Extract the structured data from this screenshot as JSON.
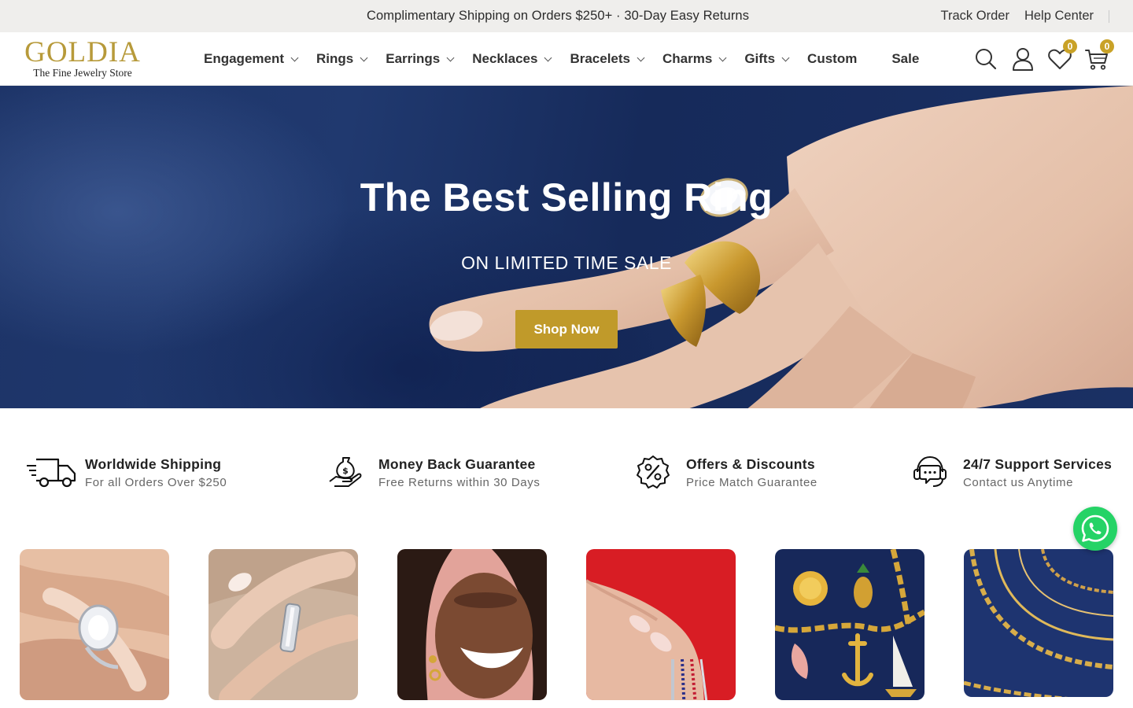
{
  "topbar": {
    "promo": "Complimentary Shipping on Orders $250+ · 30-Day Easy Returns",
    "track_order": "Track Order",
    "help_center": "Help Center"
  },
  "logo": {
    "word": "GOLDIA",
    "tagline": "The Fine Jewelry Store"
  },
  "nav": {
    "items": [
      {
        "label": "Engagement",
        "has_dropdown": true
      },
      {
        "label": "Rings",
        "has_dropdown": true
      },
      {
        "label": "Earrings",
        "has_dropdown": true
      },
      {
        "label": "Necklaces",
        "has_dropdown": true
      },
      {
        "label": "Bracelets",
        "has_dropdown": true
      },
      {
        "label": "Charms",
        "has_dropdown": true
      },
      {
        "label": "Gifts",
        "has_dropdown": true
      },
      {
        "label": "Custom",
        "has_dropdown": false
      },
      {
        "label": "Sale",
        "has_dropdown": false
      }
    ]
  },
  "header_icons": {
    "search": "search-icon",
    "account": "user-icon",
    "wishlist": "heart-icon",
    "wishlist_count": "0",
    "cart": "cart-icon",
    "cart_count": "0"
  },
  "hero": {
    "title": "The Best Selling Ring",
    "subtitle": "ON LIMITED TIME SALE",
    "cta": "Shop Now"
  },
  "features": [
    {
      "icon": "truck-icon",
      "title": "Worldwide Shipping",
      "subtitle": "For all Orders Over $250"
    },
    {
      "icon": "money-hand-icon",
      "title": "Money Back Guarantee",
      "subtitle": "Free Returns within 30 Days"
    },
    {
      "icon": "percent-badge-icon",
      "title": "Offers & Discounts",
      "subtitle": "Price Match Guarantee"
    },
    {
      "icon": "headset-icon",
      "title": "24/7 Support Services",
      "subtitle": "Contact us Anytime"
    }
  ],
  "tiles": [
    {
      "name": "engagement-ring-tile"
    },
    {
      "name": "band-ring-tile"
    },
    {
      "name": "earrings-tile"
    },
    {
      "name": "bracelets-tile"
    },
    {
      "name": "charms-tile"
    },
    {
      "name": "chains-tile"
    }
  ],
  "colors": {
    "brand_gold": "#c09a2a",
    "badge_gold": "#c9a227",
    "hero_navy": "#1d3468",
    "whatsapp_green": "#25d366"
  }
}
